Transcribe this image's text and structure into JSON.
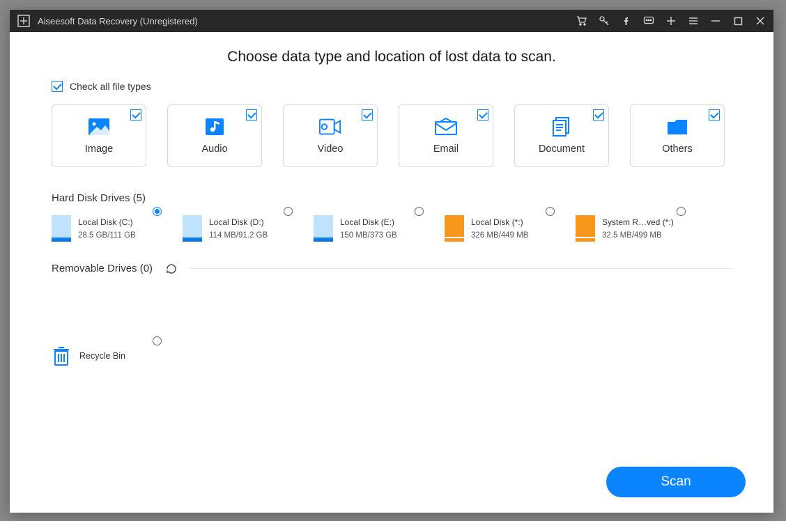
{
  "titlebar": {
    "title": "Aiseesoft Data Recovery (Unregistered)"
  },
  "main": {
    "heading": "Choose data type and location of lost data to scan.",
    "check_all_label": "Check all file types",
    "check_all_checked": true
  },
  "file_types": [
    {
      "id": "image",
      "label": "Image",
      "checked": true
    },
    {
      "id": "audio",
      "label": "Audio",
      "checked": true
    },
    {
      "id": "video",
      "label": "Video",
      "checked": true
    },
    {
      "id": "email",
      "label": "Email",
      "checked": true
    },
    {
      "id": "document",
      "label": "Document",
      "checked": true
    },
    {
      "id": "others",
      "label": "Others",
      "checked": true
    }
  ],
  "sections": {
    "hard_disk_header": "Hard Disk Drives (5)",
    "removable_header": "Removable Drives (0)"
  },
  "hard_disks": [
    {
      "name": "Local Disk (C:)",
      "size": "28.5 GB/111 GB",
      "selected": true,
      "color": "blue"
    },
    {
      "name": "Local Disk (D:)",
      "size": "114 MB/91.2 GB",
      "selected": false,
      "color": "blue"
    },
    {
      "name": "Local Disk (E:)",
      "size": "150 MB/373 GB",
      "selected": false,
      "color": "blue"
    },
    {
      "name": "Local Disk (*:)",
      "size": "326 MB/449 MB",
      "selected": false,
      "color": "orange"
    },
    {
      "name": "System R…ved (*:)",
      "size": "32.5 MB/499 MB",
      "selected": false,
      "color": "orange"
    }
  ],
  "removable_drives": [],
  "recycle": {
    "label": "Recycle Bin",
    "selected": false
  },
  "footer": {
    "scan_label": "Scan"
  }
}
